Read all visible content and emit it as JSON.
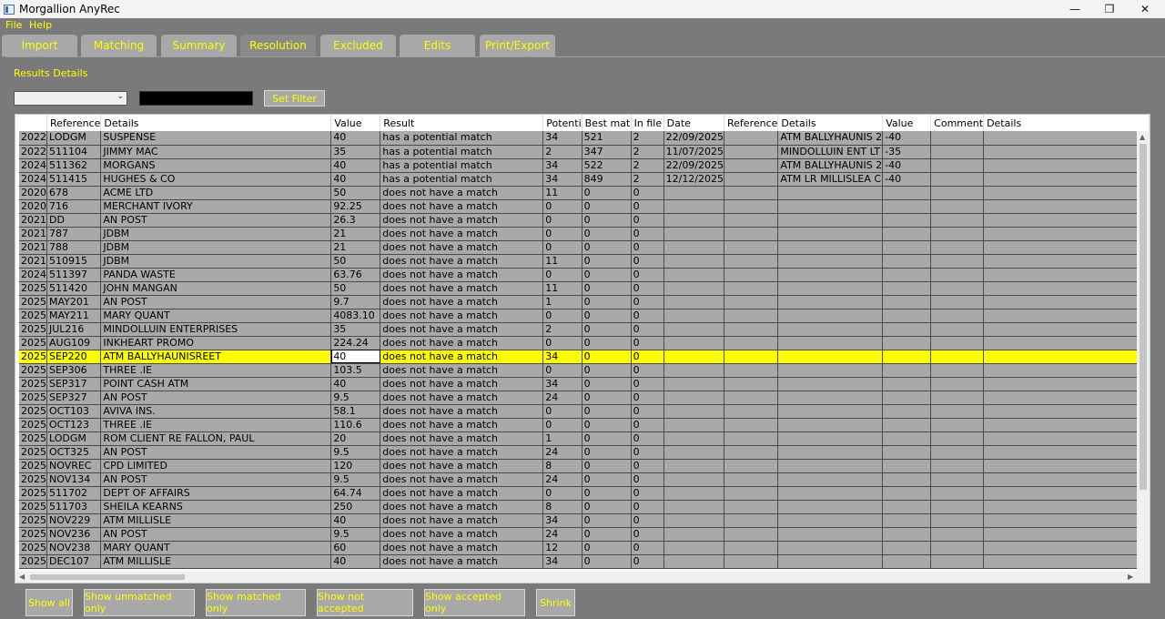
{
  "window": {
    "title": "Morgallion AnyRec",
    "minimize": "—",
    "restore": "❐",
    "close": "✕"
  },
  "menu": [
    "File",
    "Help"
  ],
  "tabs": [
    "Import",
    "Matching",
    "Summary",
    "Resolution",
    "Excluded",
    "Edits",
    "Print/Export"
  ],
  "active_tab": "Resolution",
  "section_label": "Results Details",
  "filter": {
    "select_value": "",
    "input_value": "",
    "button": "Set Filter"
  },
  "grid": {
    "columns": [
      "",
      "Reference",
      "Details",
      "Value",
      "Result",
      "Potenti",
      "Best mat",
      "In file",
      "Date",
      "Reference",
      "Details",
      "Value",
      "Comment",
      "Details"
    ],
    "rows": [
      [
        "2022",
        "LODGM",
        "SUSPENSE",
        "40",
        "has a potential match",
        "34",
        "521",
        "2",
        "22/09/2025",
        "",
        "ATM BALLYHAUNIS 2",
        "-40",
        "",
        ""
      ],
      [
        "2022",
        "511104",
        "JIMMY MAC",
        "35",
        "has a potential match",
        "2",
        "347",
        "2",
        "11/07/2025",
        "",
        "MINDOLLUIN ENT LT",
        "-35",
        "",
        ""
      ],
      [
        "2024",
        "511362",
        "MORGANS",
        "40",
        "has a potential match",
        "34",
        "522",
        "2",
        "22/09/2025",
        "",
        "ATM BALLYHAUNIS 2",
        "-40",
        "",
        ""
      ],
      [
        "2024",
        "511415",
        "HUGHES & CO",
        "40",
        "has a potential match",
        "34",
        "849",
        "2",
        "12/12/2025",
        "",
        "ATM LR MILLISLEA C",
        "-40",
        "",
        ""
      ],
      [
        "2020",
        "678",
        "ACME LTD",
        "50",
        "does not have a match",
        "11",
        "0",
        "0",
        "",
        "",
        "",
        "",
        "",
        ""
      ],
      [
        "2020",
        "716",
        "MERCHANT IVORY",
        "92.25",
        "does not have a match",
        "0",
        "0",
        "0",
        "",
        "",
        "",
        "",
        "",
        ""
      ],
      [
        "2021",
        "DD",
        "AN POST",
        "26.3",
        "does not have a match",
        "0",
        "0",
        "0",
        "",
        "",
        "",
        "",
        "",
        ""
      ],
      [
        "2021",
        "787",
        "JDBM",
        "21",
        "does not have a match",
        "0",
        "0",
        "0",
        "",
        "",
        "",
        "",
        "",
        ""
      ],
      [
        "2021",
        "788",
        "JDBM",
        "21",
        "does not have a match",
        "0",
        "0",
        "0",
        "",
        "",
        "",
        "",
        "",
        ""
      ],
      [
        "2021",
        "510915",
        "JDBM",
        "50",
        "does not have a match",
        "11",
        "0",
        "0",
        "",
        "",
        "",
        "",
        "",
        ""
      ],
      [
        "2024",
        "511397",
        "PANDA WASTE",
        "63.76",
        "does not have a match",
        "0",
        "0",
        "0",
        "",
        "",
        "",
        "",
        "",
        ""
      ],
      [
        "2025",
        "511420",
        "JOHN MANGAN",
        "50",
        "does not have a match",
        "11",
        "0",
        "0",
        "",
        "",
        "",
        "",
        "",
        ""
      ],
      [
        "2025",
        "MAY201",
        "AN POST",
        "9.7",
        "does not have a match",
        "1",
        "0",
        "0",
        "",
        "",
        "",
        "",
        "",
        ""
      ],
      [
        "2025",
        "MAY211",
        "MARY QUANT",
        "4083.10",
        "does not have a match",
        "0",
        "0",
        "0",
        "",
        "",
        "",
        "",
        "",
        ""
      ],
      [
        "2025",
        "JUL216",
        "MINDOLLUIN ENTERPRISES",
        "35",
        "does not have a match",
        "2",
        "0",
        "0",
        "",
        "",
        "",
        "",
        "",
        ""
      ],
      [
        "2025",
        "AUG109",
        "INKHEART PROMO",
        "224.24",
        "does not have a match",
        "0",
        "0",
        "0",
        "",
        "",
        "",
        "",
        "",
        ""
      ],
      [
        "2025",
        "SEP220",
        "ATM BALLYHAUNISREET",
        "40",
        "does not have a match",
        "34",
        "0",
        "0",
        "",
        "",
        "",
        "",
        "",
        ""
      ],
      [
        "2025",
        "SEP306",
        "THREE .IE",
        "103.5",
        "does not have a match",
        "0",
        "0",
        "0",
        "",
        "",
        "",
        "",
        "",
        ""
      ],
      [
        "2025",
        "SEP317",
        "POINT CASH ATM",
        "40",
        "does not have a match",
        "34",
        "0",
        "0",
        "",
        "",
        "",
        "",
        "",
        ""
      ],
      [
        "2025",
        "SEP327",
        "AN POST",
        "9.5",
        "does not have a match",
        "24",
        "0",
        "0",
        "",
        "",
        "",
        "",
        "",
        ""
      ],
      [
        "2025",
        "OCT103",
        "AVIVA INS.",
        "58.1",
        "does not have a match",
        "0",
        "0",
        "0",
        "",
        "",
        "",
        "",
        "",
        ""
      ],
      [
        "2025",
        "OCT123",
        "THREE .IE",
        "110.6",
        "does not have a match",
        "0",
        "0",
        "0",
        "",
        "",
        "",
        "",
        "",
        ""
      ],
      [
        "2025",
        "LODGM",
        "ROM CLIENT RE FALLON, PAUL",
        "20",
        "does not have a match",
        "1",
        "0",
        "0",
        "",
        "",
        "",
        "",
        "",
        ""
      ],
      [
        "2025",
        "OCT325",
        "AN POST",
        "9.5",
        "does not have a match",
        "24",
        "0",
        "0",
        "",
        "",
        "",
        "",
        "",
        ""
      ],
      [
        "2025",
        "NOVREC",
        "CPD LIMITED",
        "120",
        "does not have a match",
        "8",
        "0",
        "0",
        "",
        "",
        "",
        "",
        "",
        ""
      ],
      [
        "2025",
        "NOV134",
        "AN POST",
        "9.5",
        "does not have a match",
        "24",
        "0",
        "0",
        "",
        "",
        "",
        "",
        "",
        ""
      ],
      [
        "2025",
        "511702",
        "DEPT OF AFFAIRS",
        "64.74",
        "does not have a match",
        "0",
        "0",
        "0",
        "",
        "",
        "",
        "",
        "",
        ""
      ],
      [
        "2025",
        "511703",
        "SHEILA KEARNS",
        "250",
        "does not have a match",
        "8",
        "0",
        "0",
        "",
        "",
        "",
        "",
        "",
        ""
      ],
      [
        "2025",
        "NOV229",
        "ATM MILLISLE",
        "40",
        "does not have a match",
        "34",
        "0",
        "0",
        "",
        "",
        "",
        "",
        "",
        ""
      ],
      [
        "2025",
        "NOV236",
        "AN POST",
        "9.5",
        "does not have a match",
        "24",
        "0",
        "0",
        "",
        "",
        "",
        "",
        "",
        ""
      ],
      [
        "2025",
        "NOV238",
        "MARY QUANT",
        "60",
        "does not have a match",
        "12",
        "0",
        "0",
        "",
        "",
        "",
        "",
        "",
        ""
      ],
      [
        "2025",
        "DEC107",
        "ATM MILLISLE",
        "40",
        "does not have a match",
        "34",
        "0",
        "0",
        "",
        "",
        "",
        "",
        "",
        ""
      ]
    ],
    "selected_row": 16,
    "selected_row_color": "#ffff00"
  },
  "bottom_buttons": [
    "Show all",
    "Show unmatched only",
    "Show matched only",
    "Show not accepted",
    "Show accepted only",
    "Shrink"
  ],
  "colors": {
    "accent_text": "#ffff00",
    "background": "#7a7a7a",
    "button": "#a8a8a8"
  }
}
